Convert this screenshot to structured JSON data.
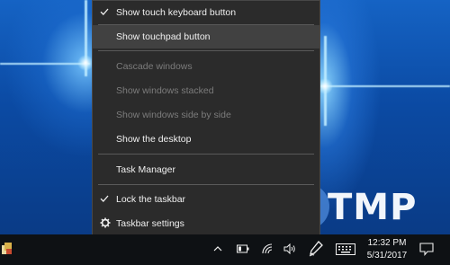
{
  "context_menu": {
    "items": [
      {
        "label": "Show touch keyboard button",
        "checked": true,
        "enabled": true
      },
      {
        "label": "Show touchpad button",
        "checked": false,
        "enabled": true,
        "highlighted": true
      },
      {
        "label": "Cascade windows",
        "checked": false,
        "enabled": false
      },
      {
        "label": "Show windows stacked",
        "checked": false,
        "enabled": false
      },
      {
        "label": "Show windows side by side",
        "checked": false,
        "enabled": false
      },
      {
        "label": "Show the desktop",
        "checked": false,
        "enabled": true
      },
      {
        "label": "Task Manager",
        "checked": false,
        "enabled": true
      },
      {
        "label": "Lock the taskbar",
        "checked": true,
        "enabled": true
      },
      {
        "label": "Taskbar settings",
        "icon": "gear-icon",
        "enabled": true
      }
    ]
  },
  "taskbar": {
    "time": "12:32 PM",
    "date": "5/31/2017",
    "tray_icons": [
      "app-icon",
      "chevron-up-icon",
      "battery-icon",
      "wifi-icon",
      "volume-icon",
      "pen-icon",
      "keyboard-icon",
      "notification-icon"
    ]
  },
  "watermark": {
    "letter": "T",
    "text": "TMP"
  },
  "colors": {
    "menu_bg": "#2b2b2b",
    "menu_highlight": "#414141",
    "taskbar_bg": "#0e1114",
    "disabled_text": "#7c7c7c"
  }
}
